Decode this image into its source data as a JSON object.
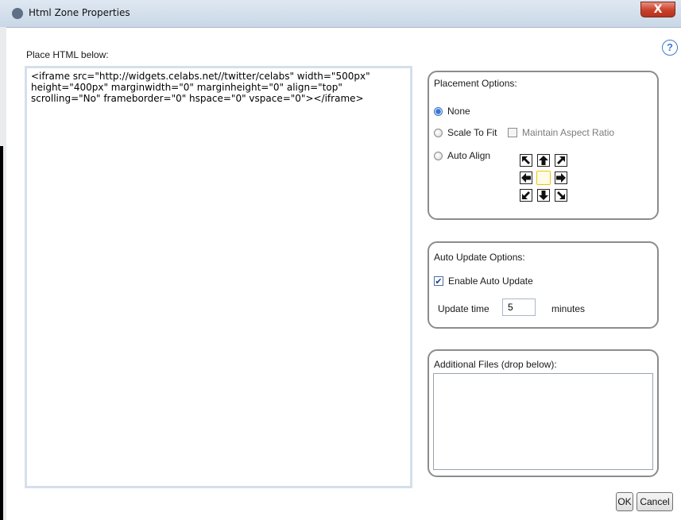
{
  "window": {
    "title": "Html Zone Properties",
    "close_label": "X"
  },
  "help": {
    "glyph": "?"
  },
  "html_section": {
    "label": "Place HTML below:",
    "value": "<iframe src=\"http://widgets.celabs.net//twitter/celabs\" width=\"500px\"\nheight=\"400px\" marginwidth=\"0\" marginheight=\"0\" align=\"top\"\nscrolling=\"No\" frameborder=\"0\" hspace=\"0\" vspace=\"0\"></iframe>"
  },
  "placement": {
    "title": "Placement Options:",
    "options": [
      {
        "label": "None",
        "selected": true
      },
      {
        "label": "Scale To Fit",
        "selected": false
      },
      {
        "label": "Auto Align",
        "selected": false
      }
    ],
    "maintain_aspect_label": "Maintain Aspect Ratio",
    "align_icons": [
      "arrow-up-left-icon",
      "arrow-up-icon",
      "arrow-up-right-icon",
      "arrow-left-icon",
      "center-icon",
      "arrow-right-icon",
      "arrow-down-left-icon",
      "arrow-down-icon",
      "arrow-down-right-icon"
    ]
  },
  "auto_update": {
    "title": "Auto Update Options:",
    "enable_label": "Enable Auto Update",
    "enabled": true,
    "time_label": "Update time",
    "time_value": "5",
    "unit_label": "minutes"
  },
  "additional_files": {
    "title": "Additional Files (drop below):"
  },
  "buttons": {
    "ok": "OK",
    "cancel": "Cancel"
  }
}
